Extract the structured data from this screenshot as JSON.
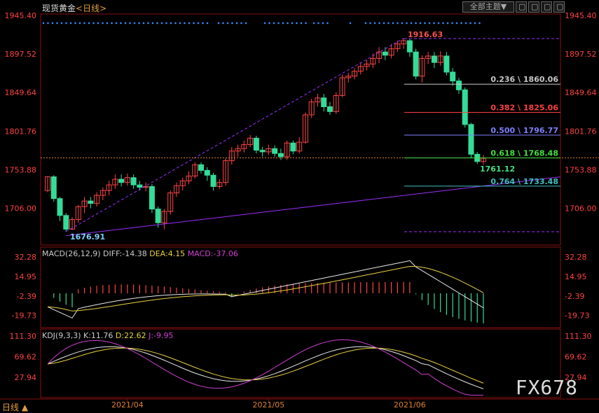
{
  "title": {
    "name": "现货黄金",
    "period": "<日线>"
  },
  "toolbar": {
    "theme_label": "全部主题",
    "dropdown_icon": "▼",
    "buttons": [
      "▢",
      "▢",
      "▢",
      "▢"
    ]
  },
  "price_axis": {
    "labels": [
      "1945.40",
      "1897.52",
      "1849.64",
      "1801.76",
      "1753.88",
      "1706.00"
    ]
  },
  "annotations": {
    "high": "1916.63",
    "low": "1676.91",
    "recent_low": "1761.12"
  },
  "fib_levels": [
    {
      "text": "0.236 \\ 1860.06",
      "color": "#c8c8c8"
    },
    {
      "text": "0.382 \\ 1825.06",
      "color": "#ff4040"
    },
    {
      "text": "0.500 \\ 1796.77",
      "color": "#8080ff"
    },
    {
      "text": "0.618 \\ 1768.48",
      "color": "#40e040"
    },
    {
      "text": "0.764 \\ 1733.48",
      "color": "#40c0c0"
    }
  ],
  "macd": {
    "name": "MACD(26,12,9)",
    "diff": "DIFF:-14.38",
    "dea": "DEA:4.15",
    "macd": "MACD:-37.06",
    "axis": [
      "32.28",
      "14.95",
      "-2.39",
      "-19.73"
    ]
  },
  "kdj": {
    "name": "KDJ(9,3,3)",
    "k": "K:11.76",
    "d": "D:22.62",
    "j": "J:-9.95",
    "axis": [
      "111.30",
      "69.62",
      "27.94"
    ]
  },
  "time_axis": [
    "2021/04",
    "2021/05",
    "2021/06"
  ],
  "bottom_left": "日线 ▲",
  "watermark": "FX678",
  "colors": {
    "up": "#ff4444",
    "down": "#33dd99",
    "grid": "#8a1010",
    "axis_text": "#ff4040"
  },
  "chart_data": {
    "type": "candlestick",
    "candles": [
      [
        1728,
        1745,
        1726,
        1746
      ],
      [
        1745,
        1718,
        1714,
        1747
      ],
      [
        1718,
        1697,
        1690,
        1720
      ],
      [
        1697,
        1680,
        1677,
        1700
      ],
      [
        1680,
        1692,
        1679,
        1695
      ],
      [
        1692,
        1708,
        1688,
        1710
      ],
      [
        1708,
        1715,
        1700,
        1720
      ],
      [
        1715,
        1712,
        1706,
        1720
      ],
      [
        1712,
        1722,
        1708,
        1726
      ],
      [
        1722,
        1728,
        1716,
        1732
      ],
      [
        1728,
        1735,
        1722,
        1740
      ],
      [
        1735,
        1742,
        1730,
        1748
      ],
      [
        1742,
        1738,
        1733,
        1748
      ],
      [
        1738,
        1744,
        1734,
        1749
      ],
      [
        1744,
        1735,
        1730,
        1748
      ],
      [
        1735,
        1732,
        1728,
        1740
      ],
      [
        1732,
        1733,
        1727,
        1738
      ],
      [
        1733,
        1705,
        1700,
        1736
      ],
      [
        1705,
        1688,
        1682,
        1708
      ],
      [
        1688,
        1702,
        1680,
        1705
      ],
      [
        1702,
        1725,
        1698,
        1728
      ],
      [
        1725,
        1734,
        1720,
        1738
      ],
      [
        1734,
        1740,
        1728,
        1744
      ],
      [
        1740,
        1746,
        1736,
        1752
      ],
      [
        1746,
        1760,
        1743,
        1763
      ],
      [
        1760,
        1753,
        1749,
        1763
      ],
      [
        1753,
        1747,
        1740,
        1757
      ],
      [
        1747,
        1733,
        1728,
        1750
      ],
      [
        1733,
        1738,
        1730,
        1742
      ],
      [
        1738,
        1765,
        1734,
        1768
      ],
      [
        1765,
        1777,
        1760,
        1782
      ],
      [
        1777,
        1780,
        1770,
        1785
      ],
      [
        1780,
        1785,
        1775,
        1790
      ],
      [
        1785,
        1793,
        1782,
        1797
      ],
      [
        1793,
        1778,
        1774,
        1796
      ],
      [
        1778,
        1776,
        1770,
        1782
      ],
      [
        1776,
        1780,
        1772,
        1785
      ],
      [
        1780,
        1774,
        1770,
        1784
      ],
      [
        1774,
        1770,
        1766,
        1780
      ],
      [
        1770,
        1787,
        1766,
        1790
      ],
      [
        1787,
        1777,
        1773,
        1790
      ],
      [
        1777,
        1788,
        1774,
        1794
      ],
      [
        1788,
        1822,
        1786,
        1825
      ],
      [
        1822,
        1838,
        1818,
        1842
      ],
      [
        1838,
        1843,
        1832,
        1848
      ],
      [
        1843,
        1832,
        1826,
        1848
      ],
      [
        1832,
        1826,
        1822,
        1838
      ],
      [
        1826,
        1846,
        1823,
        1850
      ],
      [
        1846,
        1868,
        1844,
        1872
      ],
      [
        1868,
        1870,
        1862,
        1874
      ],
      [
        1870,
        1876,
        1866,
        1880
      ],
      [
        1876,
        1882,
        1872,
        1887
      ],
      [
        1882,
        1885,
        1877,
        1890
      ],
      [
        1885,
        1892,
        1880,
        1898
      ],
      [
        1892,
        1900,
        1886,
        1906
      ],
      [
        1900,
        1896,
        1890,
        1906
      ],
      [
        1896,
        1904,
        1892,
        1910
      ],
      [
        1904,
        1910,
        1900,
        1914
      ],
      [
        1910,
        1914,
        1904,
        1917
      ],
      [
        1914,
        1900,
        1894,
        1916
      ],
      [
        1900,
        1870,
        1866,
        1904
      ],
      [
        1870,
        1892,
        1862,
        1896
      ],
      [
        1892,
        1895,
        1885,
        1900
      ],
      [
        1895,
        1887,
        1880,
        1900
      ],
      [
        1887,
        1895,
        1883,
        1901
      ],
      [
        1895,
        1875,
        1871,
        1900
      ],
      [
        1875,
        1864,
        1858,
        1880
      ],
      [
        1864,
        1853,
        1848,
        1868
      ],
      [
        1853,
        1810,
        1806,
        1856
      ],
      [
        1810,
        1773,
        1768,
        1812
      ],
      [
        1773,
        1764,
        1761,
        1776
      ],
      [
        1764,
        1768,
        1760,
        1772
      ]
    ],
    "ylim": [
      1680,
      1945.4
    ],
    "macd_range": [
      -28,
      36
    ],
    "kdj_range": [
      -10,
      120
    ]
  }
}
